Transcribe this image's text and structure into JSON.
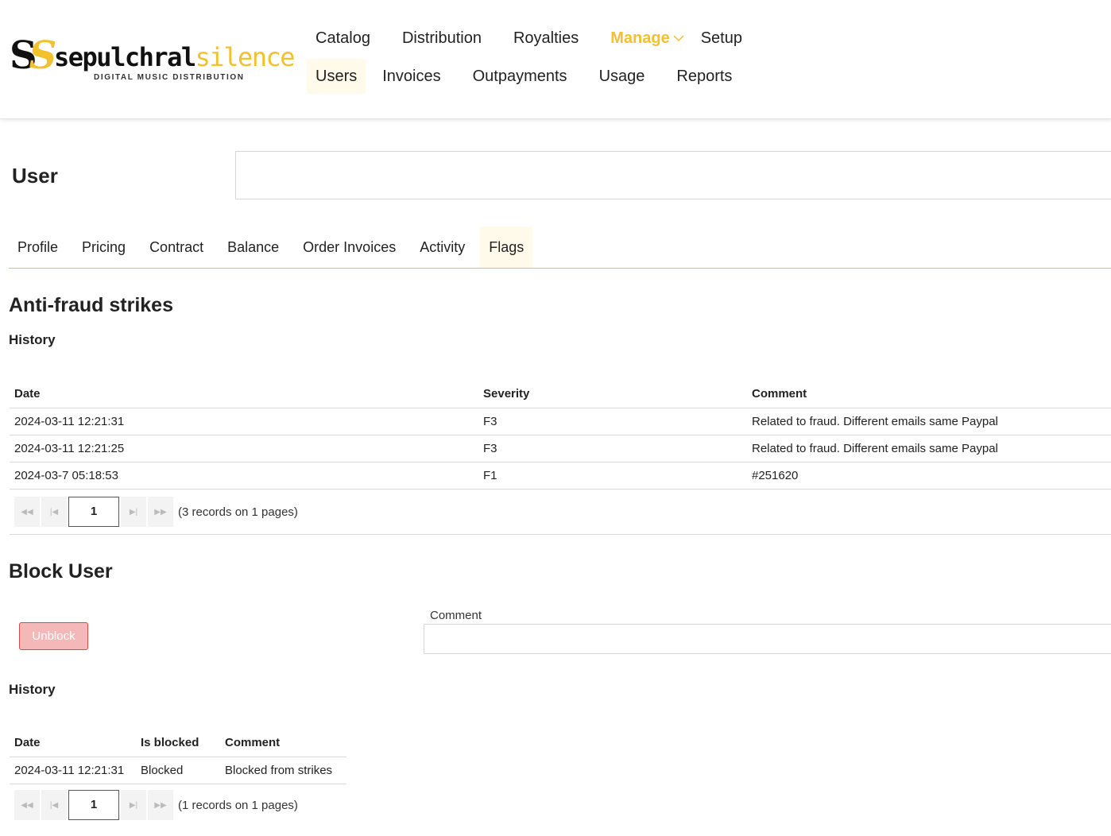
{
  "brand": {
    "monogram_a": "S",
    "monogram_b": "S",
    "word_a": "sepulchral",
    "word_b": "silence",
    "tagline": "DIGITAL MUSIC DISTRIBUTION"
  },
  "nav": {
    "row1": [
      "Catalog",
      "Distribution",
      "Royalties"
    ],
    "manage": "Manage",
    "setup": "Setup",
    "row2": [
      "Users",
      "Invoices",
      "Outpayments",
      "Usage",
      "Reports"
    ]
  },
  "user": {
    "title": "User",
    "value": ""
  },
  "tabs": [
    "Profile",
    "Pricing",
    "Contract",
    "Balance",
    "Order Invoices",
    "Activity",
    "Flags"
  ],
  "strikes": {
    "title": "Anti-fraud strikes",
    "history_title": "History",
    "headers": [
      "Date",
      "Severity",
      "Comment"
    ],
    "rows": [
      [
        "2024-03-11 12:21:31",
        "F3",
        "Related to fraud. Different emails same Paypal"
      ],
      [
        "2024-03-11 12:21:25",
        "F3",
        "Related to fraud. Different emails same Paypal"
      ],
      [
        "2024-03-7 05:18:53",
        "F1",
        "#251620"
      ]
    ],
    "pager": {
      "page": "1",
      "info": "(3 records on 1 pages)"
    }
  },
  "block": {
    "title": "Block User",
    "button_label": "Unblock",
    "comment_label": "Comment",
    "comment_value": "",
    "history_title": "History",
    "headers": [
      "Date",
      "Is blocked",
      "Comment"
    ],
    "rows": [
      [
        "2024-03-11 12:21:31",
        "Blocked",
        "Blocked from strikes"
      ]
    ],
    "pager": {
      "page": "1",
      "info": "(1 records on 1 pages)"
    }
  },
  "colors": {
    "accent": "#f2c12e",
    "active_bg": "#fffaea",
    "danger_bg": "#f5b8b8",
    "danger_border": "#d84a4a"
  }
}
